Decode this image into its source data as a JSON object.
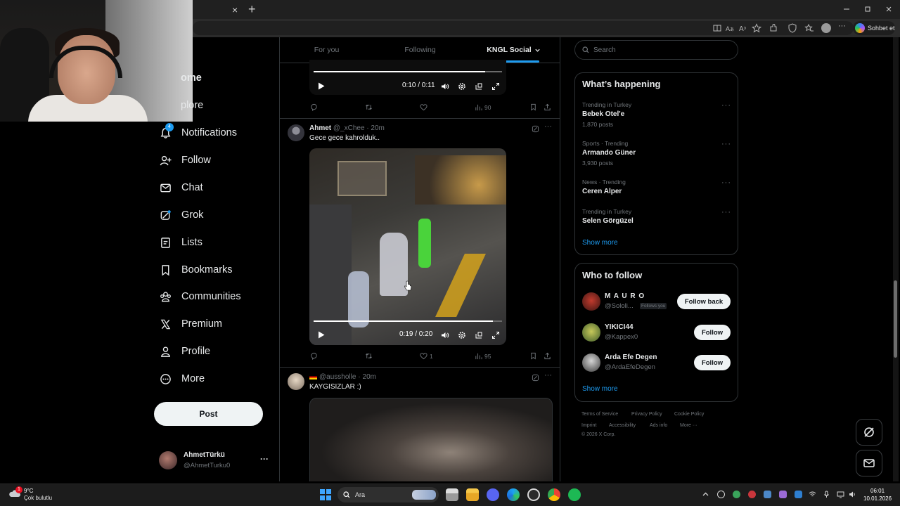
{
  "browser": {
    "new_tab_label": "+",
    "close_tab_label": "×",
    "copilot_label": "Sohbet et"
  },
  "sidebar": {
    "items": [
      {
        "label": "Home",
        "visible_label": "ome",
        "icon": "home-icon"
      },
      {
        "label": "Explore",
        "visible_label": "plore",
        "icon": "search-icon"
      },
      {
        "label": "Notifications",
        "icon": "bell-icon",
        "badge": "4"
      },
      {
        "label": "Follow",
        "icon": "add-person-icon"
      },
      {
        "label": "Chat",
        "icon": "mail-icon"
      },
      {
        "label": "Grok",
        "icon": "grok-icon"
      },
      {
        "label": "Lists",
        "icon": "list-icon"
      },
      {
        "label": "Bookmarks",
        "icon": "bookmark-icon"
      },
      {
        "label": "Communities",
        "icon": "people-icon"
      },
      {
        "label": "Premium",
        "icon": "x-logo-icon"
      },
      {
        "label": "Profile",
        "icon": "person-icon"
      },
      {
        "label": "More",
        "icon": "more-circle-icon"
      }
    ],
    "post_label": "Post",
    "account": {
      "name": "AhmetTürkü",
      "handle": "@AhmetTurku0",
      "menu": "···"
    }
  },
  "feed": {
    "tabs": [
      {
        "label": "For you",
        "active": false
      },
      {
        "label": "Following",
        "active": false
      },
      {
        "label": "KNGL Social",
        "active": true
      }
    ],
    "tweets": [
      {
        "video": {
          "time": "0:10 / 0:11",
          "progress": 0.91
        },
        "actions": {
          "replies": "",
          "reposts": "",
          "likes": "",
          "views": "90"
        }
      },
      {
        "author": "Ahmet",
        "handle": "@_xChee",
        "time": "· 20m",
        "text": "Gece gece kahrolduk..",
        "video": {
          "time": "0:19 / 0:20",
          "progress": 0.95
        },
        "actions": {
          "replies": "",
          "reposts": "",
          "likes": "1",
          "views": "95"
        }
      },
      {
        "author": "",
        "handle": "@aussholle",
        "time": "· 20m",
        "text": "KAYGISIZLAR :)"
      }
    ]
  },
  "right": {
    "search_placeholder": "Search",
    "happening": {
      "title": "What’s happening",
      "trends": [
        {
          "meta": "Trending in Turkey",
          "name": "Bebek Otel'e",
          "count": "1,870 posts"
        },
        {
          "meta": "Sports · Trending",
          "name": "Armando Güner",
          "count": "3,930 posts"
        },
        {
          "meta": "News · Trending",
          "name": "Ceren Alper",
          "count": ""
        },
        {
          "meta": "Trending in Turkey",
          "name": "Selen Görgüzel",
          "count": ""
        }
      ],
      "show_more": "Show more"
    },
    "who_to_follow": {
      "title": "Who to follow",
      "users": [
        {
          "name": "M A U R O",
          "handle": "@Sololi...",
          "badge": "Follows you",
          "button": "Follow back"
        },
        {
          "name": "YIKICI44",
          "handle": "@Kappex0",
          "badge": "",
          "button": "Follow"
        },
        {
          "name": "Arda Efe Degen",
          "handle": "@ArdaEfeDegen",
          "badge": "",
          "button": "Follow"
        }
      ],
      "show_more": "Show more"
    },
    "footer": {
      "links": [
        "Terms of Service",
        "Privacy Policy",
        "Cookie Policy",
        "Imprint",
        "Accessibility",
        "Ads info",
        "More ···"
      ],
      "copyright": "© 2026 X Corp."
    }
  },
  "taskbar": {
    "weather": {
      "temp": "9°C",
      "desc": "Çok bulutlu",
      "badge": "1"
    },
    "search_label": "Ara",
    "clock": {
      "time": "06:01",
      "date": "10.01.2026"
    }
  }
}
